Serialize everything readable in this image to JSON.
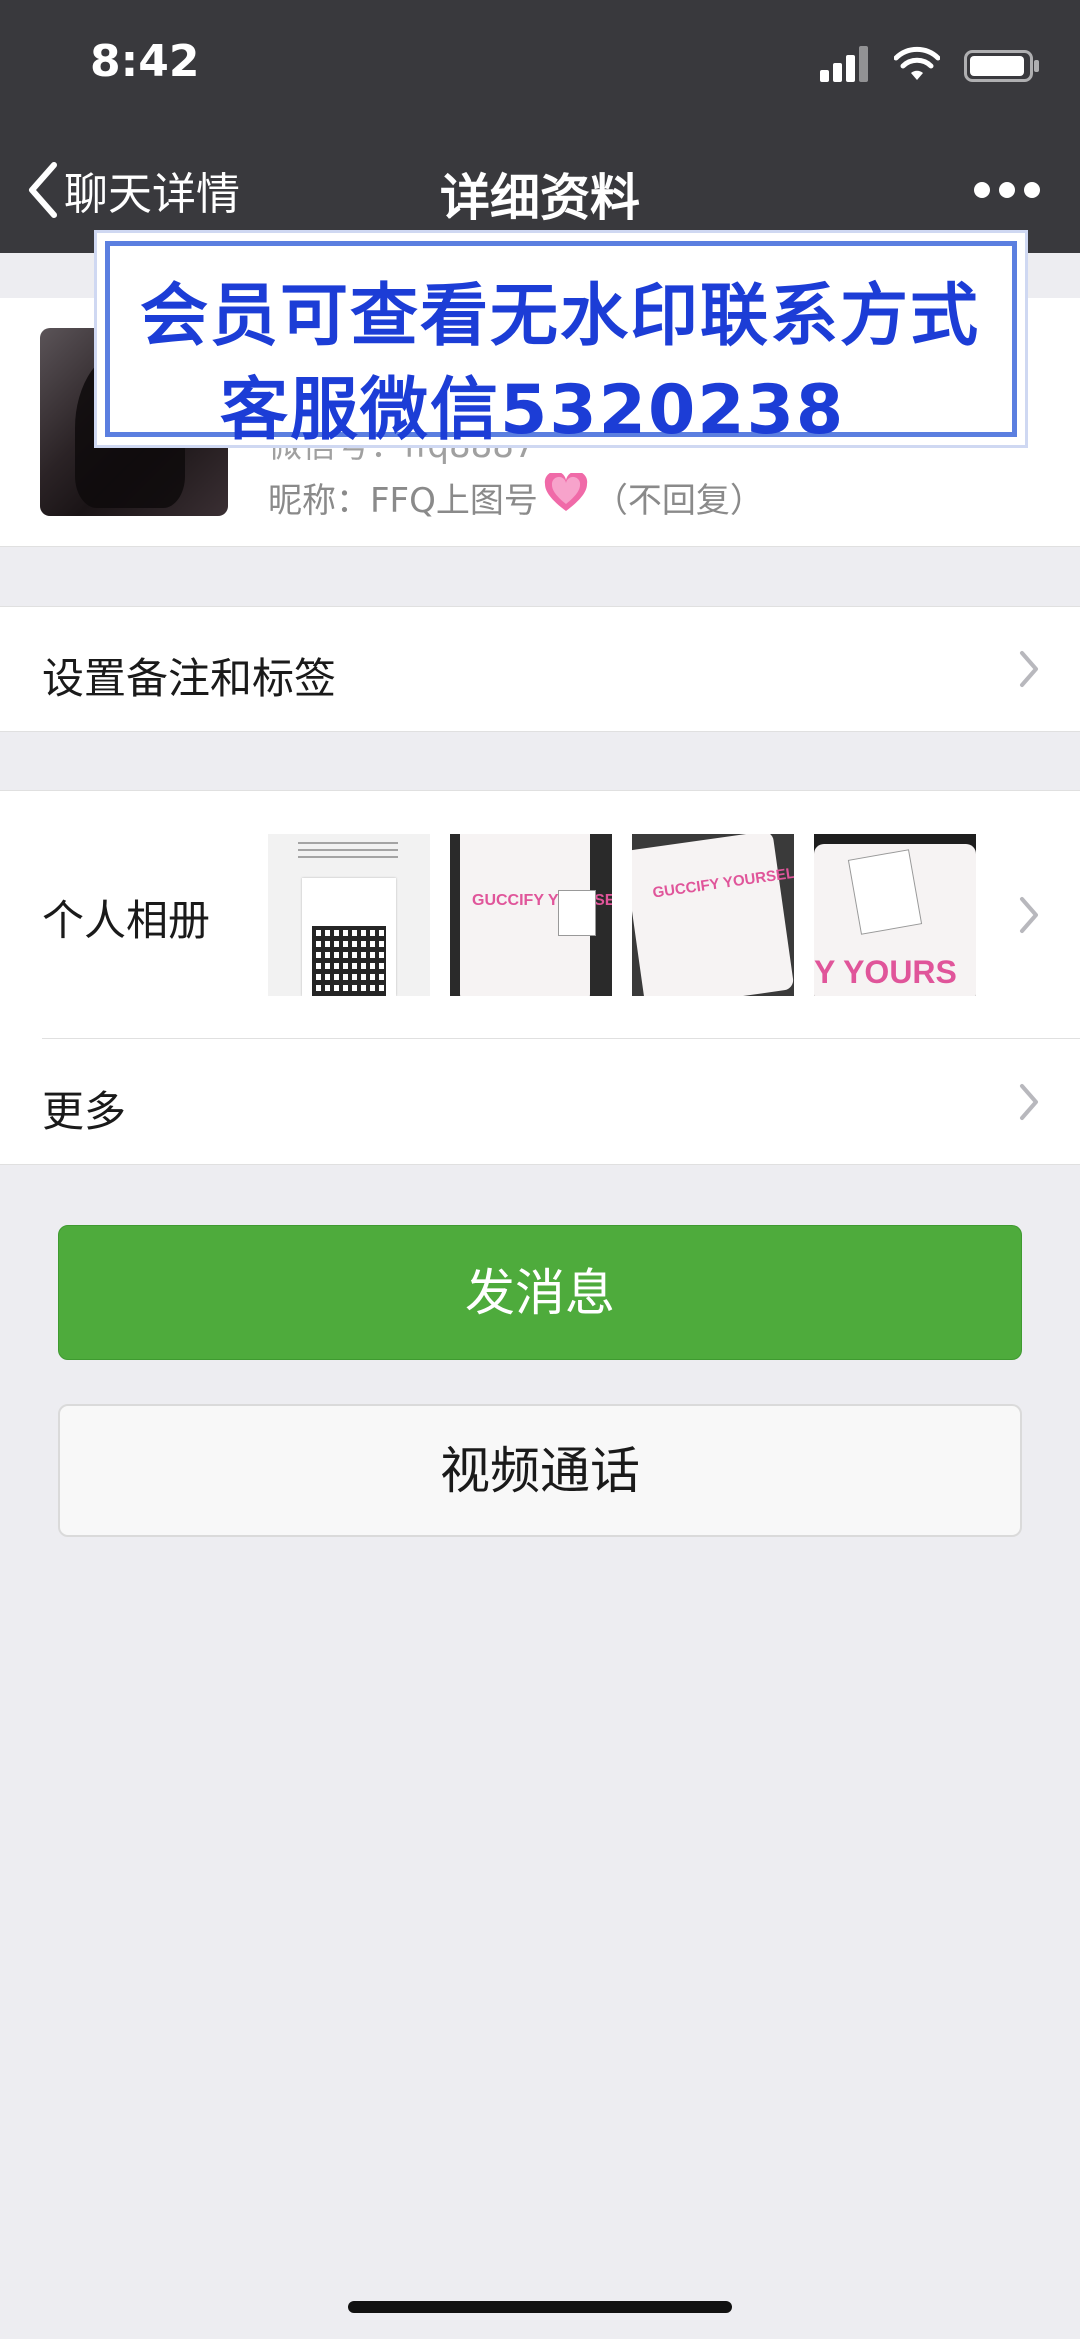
{
  "status_bar": {
    "time": "8:42"
  },
  "nav": {
    "back_label": "聊天详情",
    "title": "详细资料"
  },
  "profile": {
    "wechat_id": "微信号：ffq8887",
    "nickname_prefix": "昵称：FFQ上图号",
    "nickname_emoji": "💗",
    "nickname_suffix": "（不回复）"
  },
  "watermark": {
    "line1": "会员可查看无水印联系方式",
    "line2": "客服微信5320238"
  },
  "cells": {
    "remark": "设置备注和标签",
    "album": "个人相册",
    "more": "更多"
  },
  "album_thumbs": [
    {
      "kind": "qr",
      "print": ""
    },
    {
      "kind": "shirt",
      "print": "GUCCIFY YOURSELF"
    },
    {
      "kind": "shirt",
      "print": "GUCCIFY YOURSELF"
    },
    {
      "kind": "shirt",
      "print": "Y YOURS"
    }
  ],
  "buttons": {
    "send_message": "发消息",
    "video_call": "视频通话"
  },
  "colors": {
    "nav_bg": "#39393d",
    "page_bg": "#ededf1",
    "send_green": "#4eab3c",
    "watermark_blue": "#1c3dd6"
  }
}
